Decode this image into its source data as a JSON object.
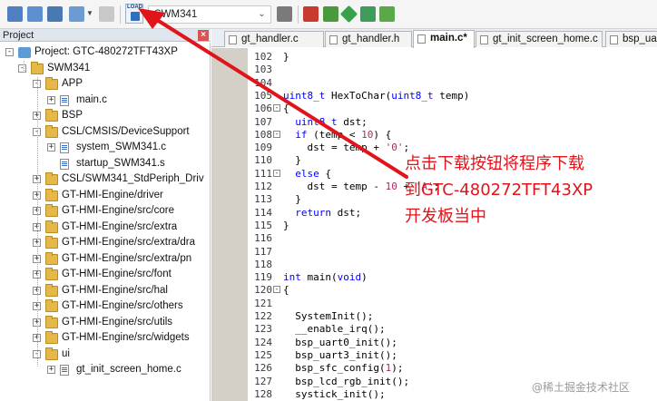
{
  "toolbar": {
    "target_name": "SWM341",
    "download_button_label": "LOAD"
  },
  "project_panel": {
    "title": "Project",
    "close": "×",
    "tree": [
      {
        "label": "Project: GTC-480272TFT43XP",
        "kind": "project",
        "indent": 0,
        "exp": "−"
      },
      {
        "label": "SWM341",
        "kind": "folder",
        "indent": 1,
        "exp": "−"
      },
      {
        "label": "APP",
        "kind": "folder",
        "indent": 2,
        "exp": "−"
      },
      {
        "label": "main.c",
        "kind": "file",
        "indent": 3,
        "exp": "+"
      },
      {
        "label": "BSP",
        "kind": "folder",
        "indent": 2,
        "exp": "+"
      },
      {
        "label": "CSL/CMSIS/DeviceSupport",
        "kind": "folder",
        "indent": 2,
        "exp": "−"
      },
      {
        "label": "system_SWM341.c",
        "kind": "file",
        "indent": 3,
        "exp": "+"
      },
      {
        "label": "startup_SWM341.s",
        "kind": "file",
        "indent": 3,
        "exp": ""
      },
      {
        "label": "CSL/SWM341_StdPeriph_Driv",
        "kind": "folder",
        "indent": 2,
        "exp": "+"
      },
      {
        "label": "GT-HMI-Engine/driver",
        "kind": "folder",
        "indent": 2,
        "exp": "+"
      },
      {
        "label": "GT-HMI-Engine/src/core",
        "kind": "folder",
        "indent": 2,
        "exp": "+"
      },
      {
        "label": "GT-HMI-Engine/src/extra",
        "kind": "folder",
        "indent": 2,
        "exp": "+"
      },
      {
        "label": "GT-HMI-Engine/src/extra/dra",
        "kind": "folder",
        "indent": 2,
        "exp": "+"
      },
      {
        "label": "GT-HMI-Engine/src/extra/pn",
        "kind": "folder",
        "indent": 2,
        "exp": "+"
      },
      {
        "label": "GT-HMI-Engine/src/font",
        "kind": "folder",
        "indent": 2,
        "exp": "+"
      },
      {
        "label": "GT-HMI-Engine/src/hal",
        "kind": "folder",
        "indent": 2,
        "exp": "+"
      },
      {
        "label": "GT-HMI-Engine/src/others",
        "kind": "folder",
        "indent": 2,
        "exp": "+"
      },
      {
        "label": "GT-HMI-Engine/src/utils",
        "kind": "folder",
        "indent": 2,
        "exp": "+"
      },
      {
        "label": "GT-HMI-Engine/src/widgets",
        "kind": "folder",
        "indent": 2,
        "exp": "+"
      },
      {
        "label": "ui",
        "kind": "folder",
        "indent": 2,
        "exp": "−"
      },
      {
        "label": "gt_init_screen_home.c",
        "kind": "file",
        "indent": 3,
        "exp": "+"
      }
    ]
  },
  "tabs": [
    {
      "label": "gt_handler.c",
      "active": false
    },
    {
      "label": "gt_handler.h",
      "active": false
    },
    {
      "label": "main.c*",
      "active": true
    },
    {
      "label": "gt_init_screen_home.c",
      "active": false
    },
    {
      "label": "bsp_uar",
      "active": false
    }
  ],
  "code": {
    "lines": [
      {
        "n": "102",
        "text": "}"
      },
      {
        "n": "103",
        "text": ""
      },
      {
        "n": "104",
        "text": ""
      },
      {
        "n": "105",
        "text": "uint8_t HexToChar(uint8_t temp)"
      },
      {
        "n": "106",
        "text": "{"
      },
      {
        "n": "107",
        "text": "  uint8_t dst;"
      },
      {
        "n": "108",
        "text": "  if (temp < 10) {"
      },
      {
        "n": "109",
        "text": "    dst = temp + '0';"
      },
      {
        "n": "110",
        "text": "  }"
      },
      {
        "n": "111",
        "text": "  else {"
      },
      {
        "n": "112",
        "text": "    dst = temp - 10 + 'A';"
      },
      {
        "n": "113",
        "text": "  }"
      },
      {
        "n": "114",
        "text": "  return dst;"
      },
      {
        "n": "115",
        "text": "}"
      },
      {
        "n": "116",
        "text": ""
      },
      {
        "n": "117",
        "text": ""
      },
      {
        "n": "118",
        "text": ""
      },
      {
        "n": "119",
        "text": "int main(void)"
      },
      {
        "n": "120",
        "text": "{"
      },
      {
        "n": "121",
        "text": ""
      },
      {
        "n": "122",
        "text": "  SystemInit();"
      },
      {
        "n": "123",
        "text": "  __enable_irq();"
      },
      {
        "n": "124",
        "text": "  bsp_uart0_init();"
      },
      {
        "n": "125",
        "text": "  bsp_uart3_init();"
      },
      {
        "n": "126",
        "text": "  bsp_sfc_config(1);"
      },
      {
        "n": "127",
        "text": "  bsp_lcd_rgb_init();"
      },
      {
        "n": "128",
        "text": "  systick_init();"
      }
    ]
  },
  "annotation": {
    "line1": "点击下载按钮将程序下载",
    "line2": "到GTC-480272TFT43XP",
    "line3": "开发板当中",
    "color": "#e0141a"
  },
  "watermark": "@稀土掘金技术社区"
}
